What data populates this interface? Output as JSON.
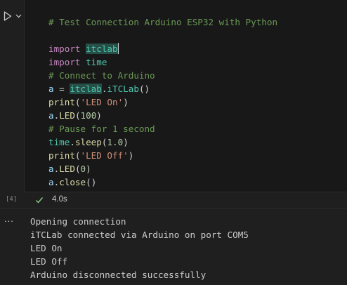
{
  "cell": {
    "execution_count": "[4]",
    "status": "success",
    "duration": "4.0s",
    "run_icon": "play-icon",
    "menu_icon": "chevron-down-icon",
    "status_icon": "check-icon"
  },
  "code": {
    "line1": {
      "comment": "# Test Connection Arduino ESP32 with Python"
    },
    "line3": {
      "kw": "import",
      "module": "itclab"
    },
    "line4": {
      "kw": "import",
      "module": "time"
    },
    "line5": {
      "comment": "# Connect to Arduino"
    },
    "line6": {
      "var": "a",
      "op": " = ",
      "module": "itclab",
      "dot": ".",
      "cls": "iTCLab",
      "parens": "()"
    },
    "line7": {
      "fn": "print",
      "open": "(",
      "str": "'LED On'",
      "close": ")"
    },
    "line8": {
      "var": "a",
      "dot": ".",
      "fn": "LED",
      "open": "(",
      "num": "100",
      "close": ")"
    },
    "line9": {
      "comment": "# Pause for 1 second"
    },
    "line10": {
      "module": "time",
      "dot": ".",
      "fn": "sleep",
      "open": "(",
      "num": "1.0",
      "close": ")"
    },
    "line11": {
      "fn": "print",
      "open": "(",
      "str": "'LED Off'",
      "close": ")"
    },
    "line12": {
      "var": "a",
      "dot": ".",
      "fn": "LED",
      "open": "(",
      "num": "0",
      "close": ")"
    },
    "line13": {
      "var": "a",
      "dot": ".",
      "fn": "close",
      "parens": "()"
    }
  },
  "output": {
    "more_label": "...",
    "lines": [
      "Opening connection",
      "iTCLab connected via Arduino on port COM5",
      "LED On",
      "LED Off",
      "Arduino disconnected successfully"
    ]
  },
  "colors": {
    "background": "#1f1f1f",
    "editor_background": "#181818",
    "comment": "#6a9955",
    "keyword": "#c586c0",
    "module": "#4ec9b0",
    "variable": "#9cdcfe",
    "function": "#dcdcaa",
    "string": "#ce9178",
    "number": "#b5cea8",
    "success": "#89d185"
  }
}
